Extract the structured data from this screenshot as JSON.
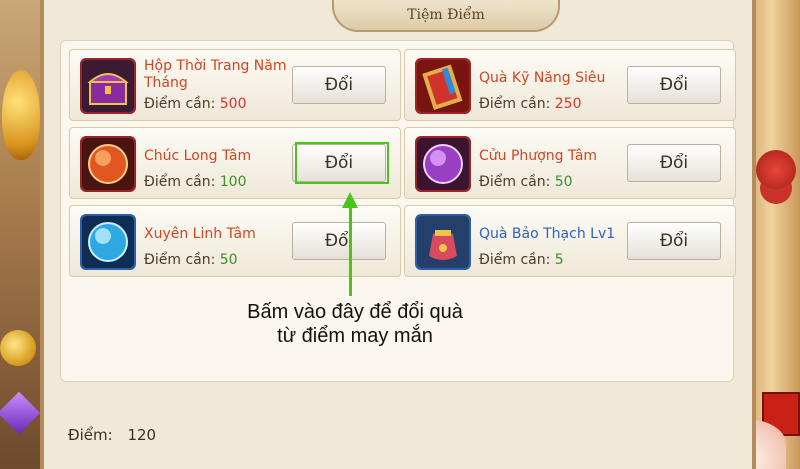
{
  "window": {
    "title": "Tiệm Điểm"
  },
  "shop": {
    "items": [
      {
        "name": "Hộp Thời Trang Năm Tháng",
        "cost_label": "Điểm cần:",
        "cost": "500",
        "cost_color": "red",
        "button_label": "Đổi",
        "icon": "treasure-chest-icon"
      },
      {
        "name": "Quà Kỹ Năng Siêu",
        "cost_label": "Điểm cần:",
        "cost": "250",
        "cost_color": "red",
        "button_label": "Đổi",
        "icon": "skill-book-icon"
      },
      {
        "name": "Chúc Long Tâm",
        "cost_label": "Điểm cần:",
        "cost": "100",
        "cost_color": "green",
        "button_label": "Đổi",
        "icon": "fire-orb-icon"
      },
      {
        "name": "Cửu Phượng Tâm",
        "cost_label": "Điểm cần:",
        "cost": "50",
        "cost_color": "green",
        "button_label": "Đổi",
        "icon": "purple-orb-icon"
      },
      {
        "name": "Xuyên Linh Tâm",
        "cost_label": "Điểm cần:",
        "cost": "50",
        "cost_color": "green",
        "button_label": "Đổi",
        "icon": "ice-orb-icon"
      },
      {
        "name": "Quà Bảo Thạch Lv1",
        "cost_label": "Điểm cần:",
        "cost": "5",
        "cost_color": "green",
        "button_label": "Đổi",
        "icon": "gem-bag-icon"
      }
    ]
  },
  "callout": {
    "line1": "Bấm vào đây để đổi quà",
    "line2": "từ điểm may mắn",
    "color": "#4ac61a"
  },
  "footer": {
    "points_label": "Điểm:",
    "points_value": "120"
  }
}
